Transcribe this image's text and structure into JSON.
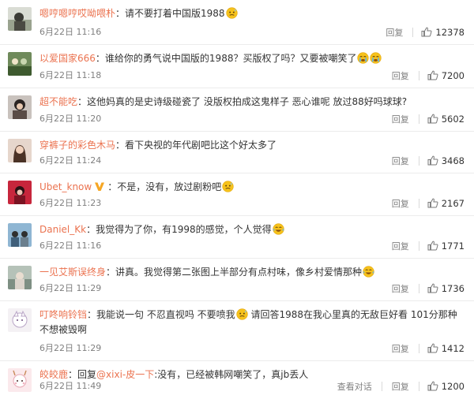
{
  "comments": [
    {
      "user": "嗯哼嗯哼哎呦喂朴",
      "text": "请不要打着中国版1988",
      "emoji": "sweat-face",
      "time": "6月22日 11:16",
      "reply": "回复",
      "likes": "12378"
    },
    {
      "user": "以爱国家666",
      "text": "谁给你的勇气说中国版的1988？买版权了吗？又要被嘲笑了",
      "emoji": "crying-face-x2",
      "time": "6月22日 11:18",
      "reply": "回复",
      "likes": "7200"
    },
    {
      "user": "超不能吃",
      "text": "这他妈真的是史诗级碰瓷了 没版权拍成这鬼样子 恶心谁呢 放过88好吗球球?",
      "time": "6月22日 11:20",
      "reply": "回复",
      "likes": "5602"
    },
    {
      "user": "穿裤子的彩色木马",
      "text": "看下央视的年代剧吧比这个好太多了",
      "time": "6月22日 11:24",
      "reply": "回复",
      "likes": "3468"
    },
    {
      "user": "Ubet_know",
      "text": "不是，没有，放过剧粉吧",
      "emoji": "sweat-face",
      "time": "6月22日 11:23",
      "reply": "回复",
      "likes": "2167",
      "verified": true
    },
    {
      "user": "Daniel_Kk",
      "text": "我觉得为了你，有1998的感觉，个人觉得",
      "emoji": "laugh-tears-face",
      "time": "6月22日 11:16",
      "reply": "回复",
      "likes": "1771"
    },
    {
      "user": "一见艾斯误终身",
      "text": "讲真。我觉得第二张图上半部分有点村味，像乡村爱情那种",
      "emoji": "laugh-tears-face",
      "time": "6月22日 11:29",
      "reply": "回复",
      "likes": "1736"
    },
    {
      "user": "叮咚响铃铛",
      "text_a": "我能说一句 不忍直视吗 不要喷我",
      "emoji": "sweat-face",
      "text_b": "请回答1988在我心里真的无敌巨好看 101分那种 不想被毁啊",
      "time": "6月22日 11:29",
      "reply": "回复",
      "likes": "1412"
    },
    {
      "user": "皎皎鹿",
      "prefix": "回复",
      "reply_to": "@xixi-皮一下",
      "text": ":没有，已经被韩网嘲笑了，真jb丢人",
      "time": "6月22日 11:49",
      "view_thread": "查看对话",
      "reply": "回复",
      "likes": "1200"
    }
  ],
  "colors": {
    "username": "#eb7350",
    "meta": "#808080",
    "divider": "#ececec"
  }
}
